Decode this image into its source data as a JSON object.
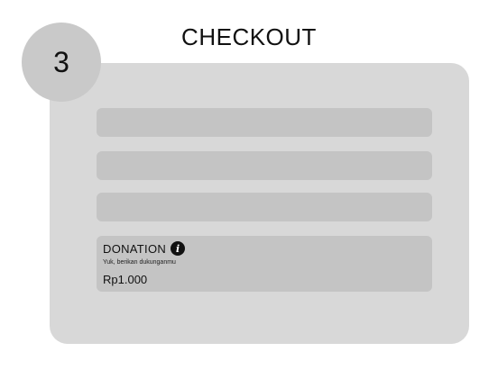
{
  "header": {
    "title": "CHECKOUT",
    "step_number": "3"
  },
  "form": {
    "fields": [
      {
        "value": ""
      },
      {
        "value": ""
      },
      {
        "value": ""
      }
    ]
  },
  "donation": {
    "title": "DONATION",
    "info_icon": "info-icon",
    "subtitle": "Yuk, berikan dukunganmu",
    "amount": "Rp1.000"
  },
  "colors": {
    "background": "#ffffff",
    "card": "#d8d8d8",
    "field": "#c4c4c4",
    "step_circle": "#c9c9c9",
    "text": "#111111"
  }
}
